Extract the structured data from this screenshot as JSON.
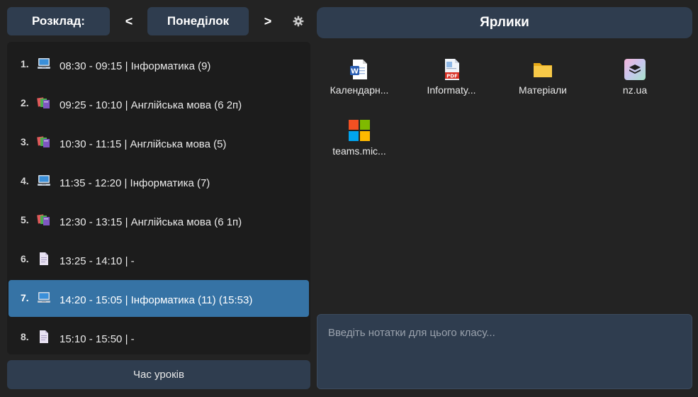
{
  "header": {
    "schedule_label": "Розклад:",
    "prev_label": "<",
    "day_label": "Понеділок",
    "next_label": ">",
    "settings_icon": "gear-icon"
  },
  "lessons": [
    {
      "num": "1.",
      "icon": "computer-icon",
      "text": "08:30 - 09:15 | Інформатика (9)",
      "selected": false
    },
    {
      "num": "2.",
      "icon": "books-icon",
      "text": "09:25 - 10:10 | Англійська мова (6 2п)",
      "selected": false
    },
    {
      "num": "3.",
      "icon": "books-icon",
      "text": "10:30 - 11:15 | Англійська мова (5)",
      "selected": false
    },
    {
      "num": "4.",
      "icon": "computer-icon",
      "text": "11:35 - 12:20 | Інформатика (7)",
      "selected": false
    },
    {
      "num": "5.",
      "icon": "books-icon",
      "text": "12:30 - 13:15 | Англійська мова (6 1п)",
      "selected": false
    },
    {
      "num": "6.",
      "icon": "document-icon",
      "text": "13:25 - 14:10 | -",
      "selected": false
    },
    {
      "num": "7.",
      "icon": "computer-icon",
      "text": "14:20 - 15:05 | Інформатика (11) (15:53)",
      "selected": true
    },
    {
      "num": "8.",
      "icon": "document-icon",
      "text": "15:10 - 15:50 | -",
      "selected": false
    }
  ],
  "times_button_label": "Час уроків",
  "shortcuts": {
    "title": "Ярлики",
    "items": [
      {
        "label": "Календарн...",
        "icon": "word-doc-icon"
      },
      {
        "label": "Informaty...",
        "icon": "pdf-icon"
      },
      {
        "label": "Матеріали",
        "icon": "folder-icon"
      },
      {
        "label": "nz.ua",
        "icon": "nz-ua-icon"
      },
      {
        "label": "teams.mic...",
        "icon": "microsoft-logo-icon"
      }
    ]
  },
  "notes": {
    "placeholder": "Введіть нотатки для цього класу..."
  },
  "colors": {
    "background": "#232323",
    "panel": "#1c1c1c",
    "button": "#2f3d4f",
    "selected": "#3673a5"
  }
}
